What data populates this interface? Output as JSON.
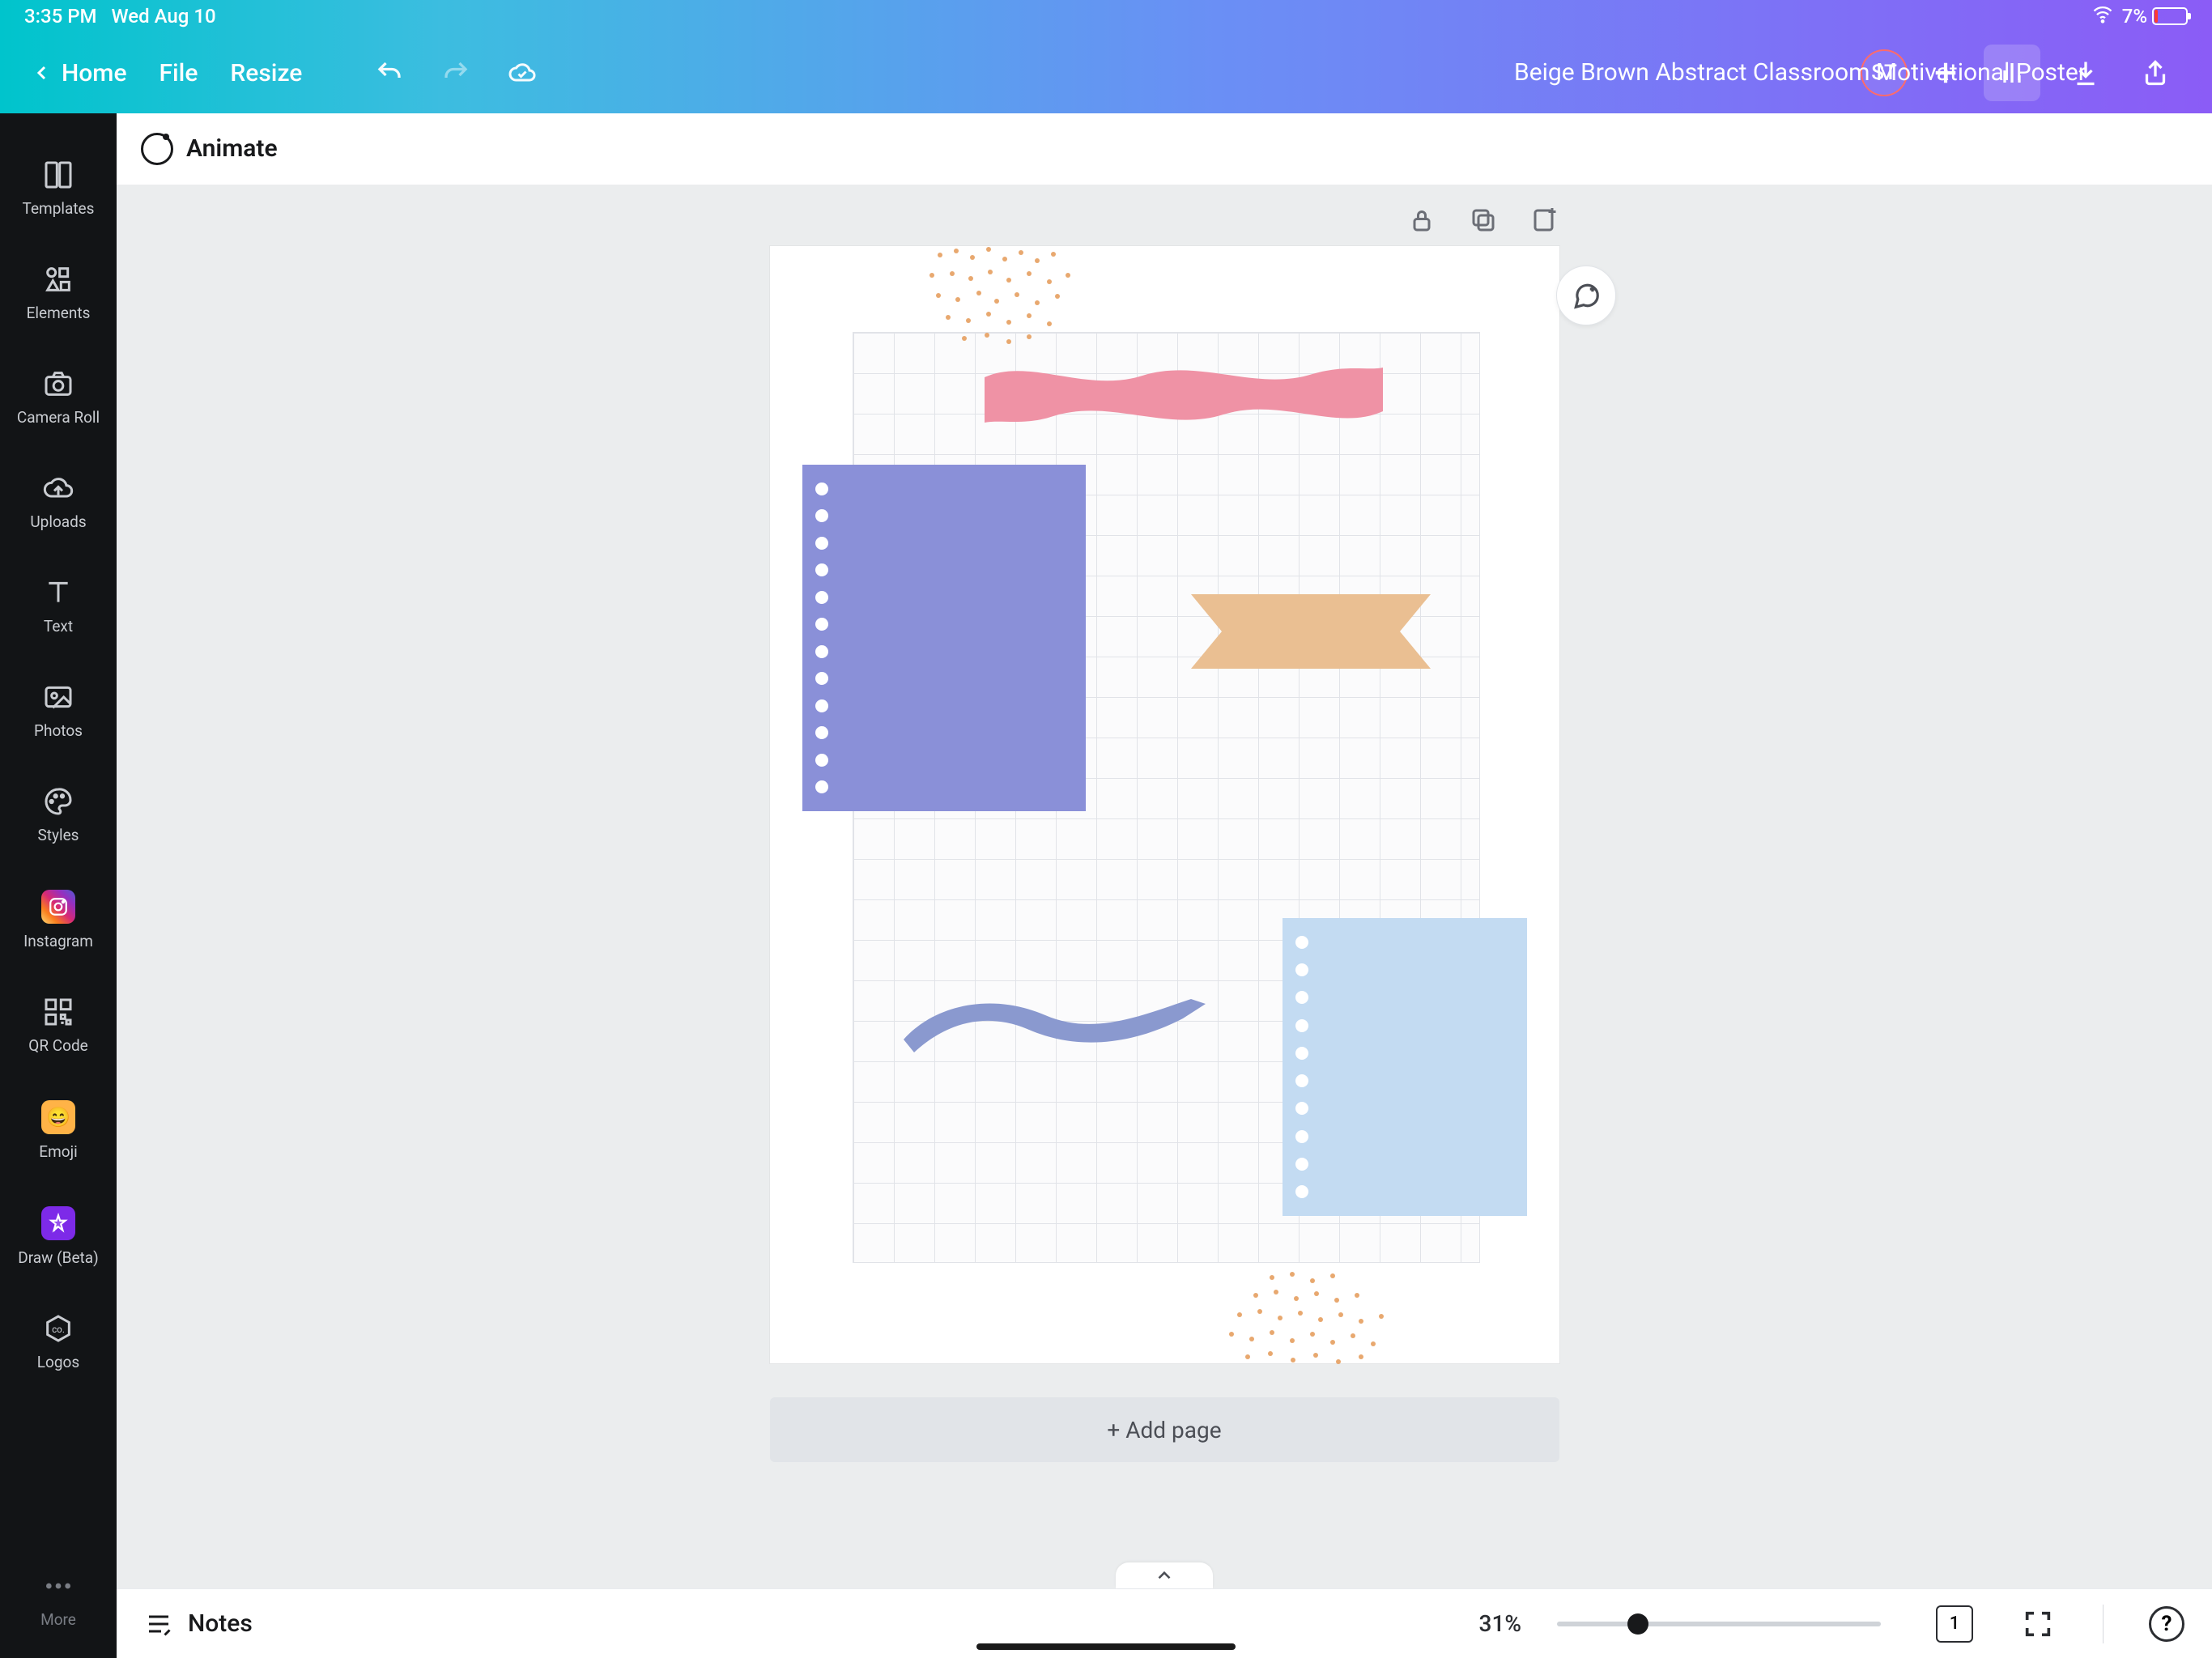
{
  "status": {
    "time": "3:35 PM",
    "date": "Wed Aug 10",
    "battery_pct": "7%"
  },
  "topbar": {
    "home": "Home",
    "file": "File",
    "resize": "Resize",
    "doc_title": "Beige Brown Abstract Classroom Motivational Poster",
    "avatar_initials": "ST"
  },
  "context": {
    "animate": "Animate"
  },
  "rail": {
    "templates": "Templates",
    "elements": "Elements",
    "camera_roll": "Camera Roll",
    "uploads": "Uploads",
    "text": "Text",
    "photos": "Photos",
    "styles": "Styles",
    "instagram": "Instagram",
    "qr_code": "QR Code",
    "emoji": "Emoji",
    "draw": "Draw (Beta)",
    "logos": "Logos",
    "more": "More"
  },
  "canvas": {
    "add_page": "+ Add page"
  },
  "bottom": {
    "notes": "Notes",
    "zoom": "31%",
    "page_indicator": "1"
  }
}
